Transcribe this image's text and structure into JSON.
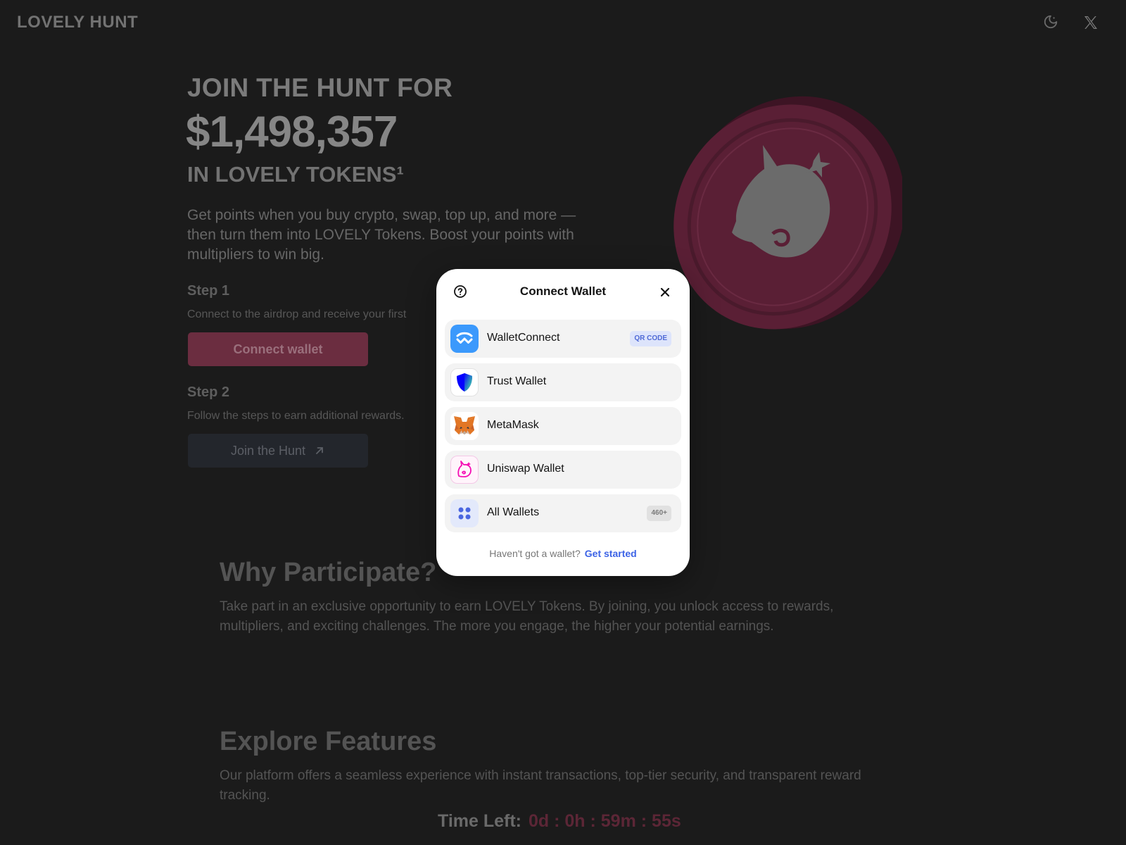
{
  "header": {
    "logo": "LOVELY HUNT",
    "theme_icon": "moon-icon",
    "social_icon": "x-logo-icon"
  },
  "hero": {
    "pre_title": "JOIN THE HUNT FOR",
    "amount": "$1,498,357",
    "post_title": "IN LOVELY TOKENS¹",
    "description": "Get points when you buy crypto, swap, top up, and more — then turn them into LOVELY Tokens. Boost your points with multipliers to win big."
  },
  "steps": [
    {
      "title": "Step 1",
      "description": "Connect to the airdrop and receive your first",
      "button": "Connect wallet"
    },
    {
      "title": "Step 2",
      "description": "Follow the steps to earn additional rewards.",
      "button": "Join the Hunt"
    }
  ],
  "sections": [
    {
      "title": "Why Participate?",
      "text": "Take part in an exclusive opportunity to earn LOVELY Tokens. By joining, you unlock access to rewards, multipliers, and exciting challenges. The more you engage, the higher your potential earnings."
    },
    {
      "title": "Explore Features",
      "text": "Our platform offers a seamless experience with instant transactions, top-tier security, and transparent reward tracking."
    }
  ],
  "timer": {
    "label": "Time Left:",
    "value": "0d : 0h : 59m : 55s"
  },
  "modal": {
    "title": "Connect Wallet",
    "help_icon": "help-circle-icon",
    "close_icon": "close-icon",
    "wallets": [
      {
        "name": "WalletConnect",
        "icon": "walletconnect-icon",
        "tag": "QR CODE"
      },
      {
        "name": "Trust Wallet",
        "icon": "trust-wallet-shield-icon"
      },
      {
        "name": "MetaMask",
        "icon": "metamask-fox-icon"
      },
      {
        "name": "Uniswap Wallet",
        "icon": "uniswap-unicorn-icon"
      },
      {
        "name": "All Wallets",
        "icon": "grid-icon",
        "tag": "460+"
      }
    ],
    "footer_question": "Haven't got a wallet?",
    "footer_link": "Get started"
  },
  "colors": {
    "background": "#1b1b1b",
    "modal_bg": "#ffffff",
    "accent_link": "#3c63e6",
    "connect_button": "#6b2d40",
    "coin": "#5a1f35"
  }
}
